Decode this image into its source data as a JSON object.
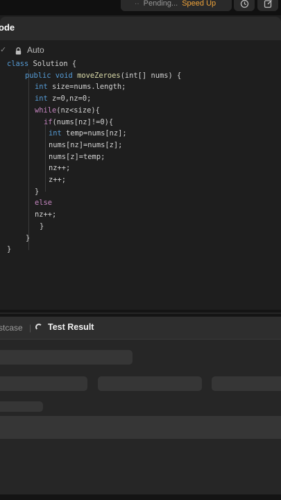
{
  "topbar": {
    "status_dots": "··",
    "pending_label": "Pending...",
    "speed_up_label": "Speed Up",
    "icons": [
      "history-icon",
      "note-icon"
    ]
  },
  "code_panel": {
    "title": "ode",
    "language_chevron": "✓",
    "mode_label": "Auto",
    "lines": [
      [
        "class",
        " Solution {"
      ],
      [
        "public void",
        " moveZeroes(int[] nums) {"
      ],
      [
        "int",
        " size=nums.length;"
      ],
      [
        "int",
        " z=0,nz=0;"
      ],
      [
        "while",
        "(nz<size){"
      ],
      [
        "if",
        "(nums[nz]!=0){"
      ],
      [
        "int",
        " temp=nums[nz];"
      ],
      [
        "",
        "nums[nz]=nums[z];"
      ],
      [
        "",
        "nums[z]=temp;"
      ],
      [
        "",
        "nz++;"
      ],
      [
        "",
        "z++;"
      ],
      [
        "",
        "}"
      ],
      [
        "else",
        ""
      ],
      [
        "",
        "nz++;"
      ],
      [
        "",
        "}"
      ],
      [
        "",
        "}"
      ],
      [
        "",
        "}"
      ]
    ]
  },
  "result_panel": {
    "tab_testcase": "stcase",
    "tab_separator": "|",
    "tab_result": "Test Result"
  },
  "colors": {
    "accent_orange": "#f0a43a",
    "keyword_blue": "#569cd6",
    "keyword_purple": "#c586c0"
  }
}
